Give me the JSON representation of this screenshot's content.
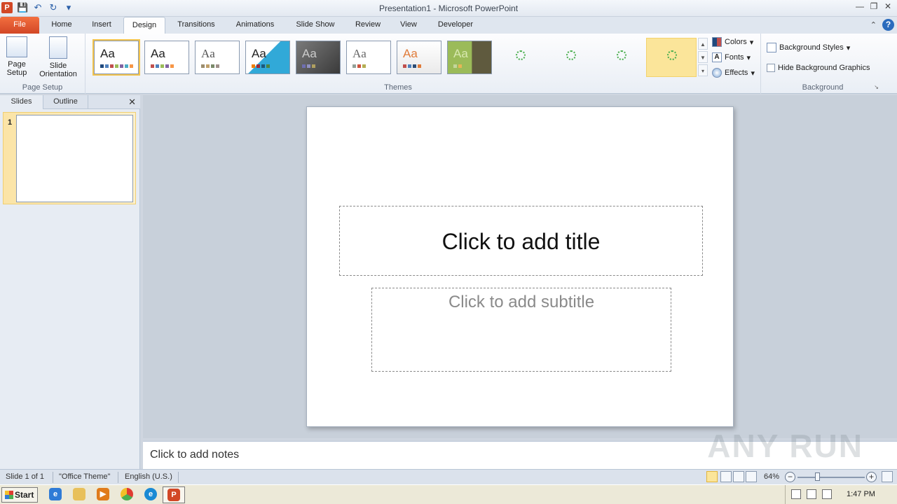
{
  "window": {
    "title": "Presentation1 - Microsoft PowerPoint"
  },
  "tabs": [
    "File",
    "Home",
    "Insert",
    "Design",
    "Transitions",
    "Animations",
    "Slide Show",
    "Review",
    "View",
    "Developer"
  ],
  "ribbon": {
    "page_setup": {
      "page_setup_label": "Page\nSetup",
      "orientation_label": "Slide\nOrientation",
      "group_label": "Page Setup"
    },
    "themes": {
      "group_label": "Themes",
      "sample_text": "Aa"
    },
    "theme_options": {
      "colors": "Colors",
      "fonts": "Fonts",
      "effects": "Effects"
    },
    "background": {
      "styles": "Background Styles",
      "hide_graphics": "Hide Background Graphics",
      "group_label": "Background"
    }
  },
  "left_panel": {
    "tab_slides": "Slides",
    "tab_outline": "Outline",
    "slide_number": "1"
  },
  "slide": {
    "title_placeholder": "Click to add title",
    "subtitle_placeholder": "Click to add subtitle"
  },
  "notes": {
    "placeholder": "Click to add notes"
  },
  "status_bar": {
    "slide_info": "Slide 1 of 1",
    "theme": "\"Office Theme\"",
    "language": "English (U.S.)",
    "zoom": "64%"
  },
  "taskbar": {
    "start": "Start",
    "clock": "1:47 PM"
  },
  "watermark": "ANY RUN",
  "colors": {
    "file_tab": "#d24726",
    "selection": "#fbe59a"
  }
}
